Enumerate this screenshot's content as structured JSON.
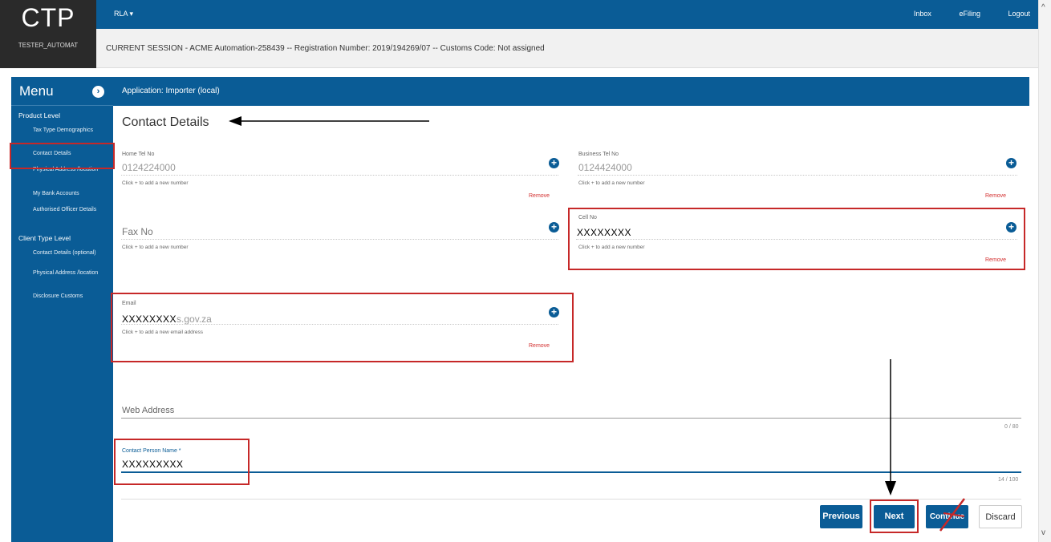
{
  "brand": {
    "logo": "CTP",
    "user": "TESTER_AUTOMAT"
  },
  "topbar": {
    "rla_menu": "RLA",
    "links": [
      "Inbox",
      "eFiling",
      "Logout"
    ]
  },
  "session": {
    "text": "CURRENT SESSION - ACME Automation-258439 -- Registration Number: 2019/194269/07 -- Customs Code: Not assigned"
  },
  "sidebar": {
    "title": "Menu",
    "product_level": "Product Level",
    "product_items": [
      "Tax Type Demographics",
      "Contact Details",
      "Physical Address /location",
      "My Bank Accounts",
      "Authorised Officer Details"
    ],
    "client_level": "Client Type Level",
    "client_items": [
      "Contact Details (optional)",
      "Physical Address /location",
      "Disclosure Customs"
    ]
  },
  "app_header": "Application: Importer (local)",
  "page_title": "Contact Details",
  "fields": {
    "home_tel": {
      "label": "Home Tel No",
      "value": "0124224000",
      "help": "Click + to add a new number",
      "remove": "Remove"
    },
    "business_tel": {
      "label": "Business Tel No",
      "value": "0124424000",
      "help": "Click + to add a new number",
      "remove": "Remove"
    },
    "fax": {
      "label": "Fax No",
      "help": "Click + to add a new number"
    },
    "cell": {
      "label": "Cell No",
      "value": "XXXXXXXX",
      "help": "Click + to add a new number",
      "remove": "Remove"
    },
    "email": {
      "label": "Email",
      "value_masked": "XXXXXXXX",
      "value_suffix": "s.gov.za",
      "help": "Click + to add a new email address",
      "remove": "Remove"
    },
    "web": {
      "label": "Web Address",
      "counter": "0 / 80"
    },
    "contact_person": {
      "label": "Contact Person Name *",
      "value": "XXXXXXXXX",
      "counter": "14 / 100"
    }
  },
  "buttons": {
    "previous": "Previous",
    "next": "Next",
    "continue": "Continue",
    "discard": "Discard"
  },
  "colors": {
    "primary": "#0a5c96",
    "annotation": "#c62828",
    "remove": "#d32f2f"
  }
}
